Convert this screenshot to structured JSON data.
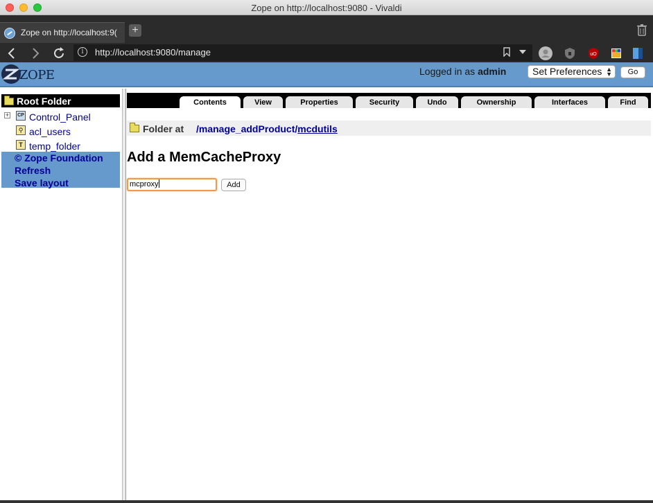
{
  "window": {
    "title": "Zope on http://localhost:9080 - Vivaldi"
  },
  "browser": {
    "tab_title": "Zope on http://localhost:9080 - Vivaldi",
    "tab_title_visible": "Zope on http://localhost:9(",
    "new_tab_label": "+",
    "url": "http://localhost:9080/manage",
    "info_glyph": "i"
  },
  "zope_header": {
    "logo_text": "ZOPE",
    "logged_in_prefix": "Logged in as",
    "user": "admin",
    "preferences_select": "Set Preferences",
    "go_button": "Go"
  },
  "tree": {
    "root": "Root Folder",
    "items": [
      {
        "label": "Control_Panel",
        "expander": "+",
        "icon": "control-panel-icon",
        "glyph": "CP"
      },
      {
        "label": "acl_users",
        "icon": "user-folder-icon",
        "glyph": "⚲"
      },
      {
        "label": "temp_folder",
        "icon": "temp-folder-icon",
        "glyph": "T"
      }
    ],
    "links": [
      "© Zope Foundation",
      "Refresh",
      "Save layout"
    ]
  },
  "tabs": [
    "Contents",
    "View",
    "Properties",
    "Security",
    "Undo",
    "Ownership",
    "Interfaces",
    "Find"
  ],
  "location": {
    "label": "Folder at",
    "path_prefix": "/manage_addProduct/",
    "path_link": "mcdutils"
  },
  "form": {
    "title": "Add a MemCacheProxy",
    "id_value": "mcproxy",
    "add_button": "Add"
  },
  "colors": {
    "zope_blue": "#6699cc",
    "link_blue": "#000099",
    "input_focus": "#f3984a"
  }
}
